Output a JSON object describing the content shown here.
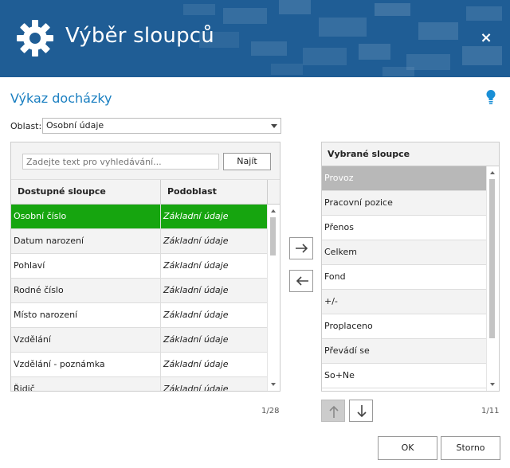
{
  "header": {
    "title": "Výběr sloupců",
    "close_label": "×",
    "bg_color": "#1f5d95"
  },
  "subtitle": "Výkaz docházky",
  "oblast": {
    "label": "Oblast:",
    "value": "Osobní údaje"
  },
  "search": {
    "placeholder": "Zadejte text pro vyhledávání...",
    "button_label": "Najít"
  },
  "available": {
    "col1_header": "Dostupné sloupce",
    "col2_header": "Podoblast",
    "rows": [
      {
        "name": "Osobní číslo",
        "sub": "Základní údaje"
      },
      {
        "name": "Datum narození",
        "sub": "Základní údaje"
      },
      {
        "name": "Pohlaví",
        "sub": "Základní údaje"
      },
      {
        "name": "Rodné číslo",
        "sub": "Základní údaje"
      },
      {
        "name": "Místo narození",
        "sub": "Základní údaje"
      },
      {
        "name": "Vzdělání",
        "sub": "Základní údaje"
      },
      {
        "name": "Vzdělání - poznámka",
        "sub": "Základní údaje"
      },
      {
        "name": "Řidič",
        "sub": "Základní údaje"
      }
    ],
    "count": "1/28",
    "selected_color": "#16a50f"
  },
  "selected": {
    "header": "Vybrané sloupce",
    "rows": [
      "Provoz",
      "Pracovní pozice",
      "Přenos",
      "Celkem",
      "Fond",
      "+/-",
      "Proplaceno",
      "Převádí se",
      "So+Ne"
    ],
    "count": "1/11"
  },
  "footer": {
    "ok_label": "OK",
    "cancel_label": "Storno"
  }
}
